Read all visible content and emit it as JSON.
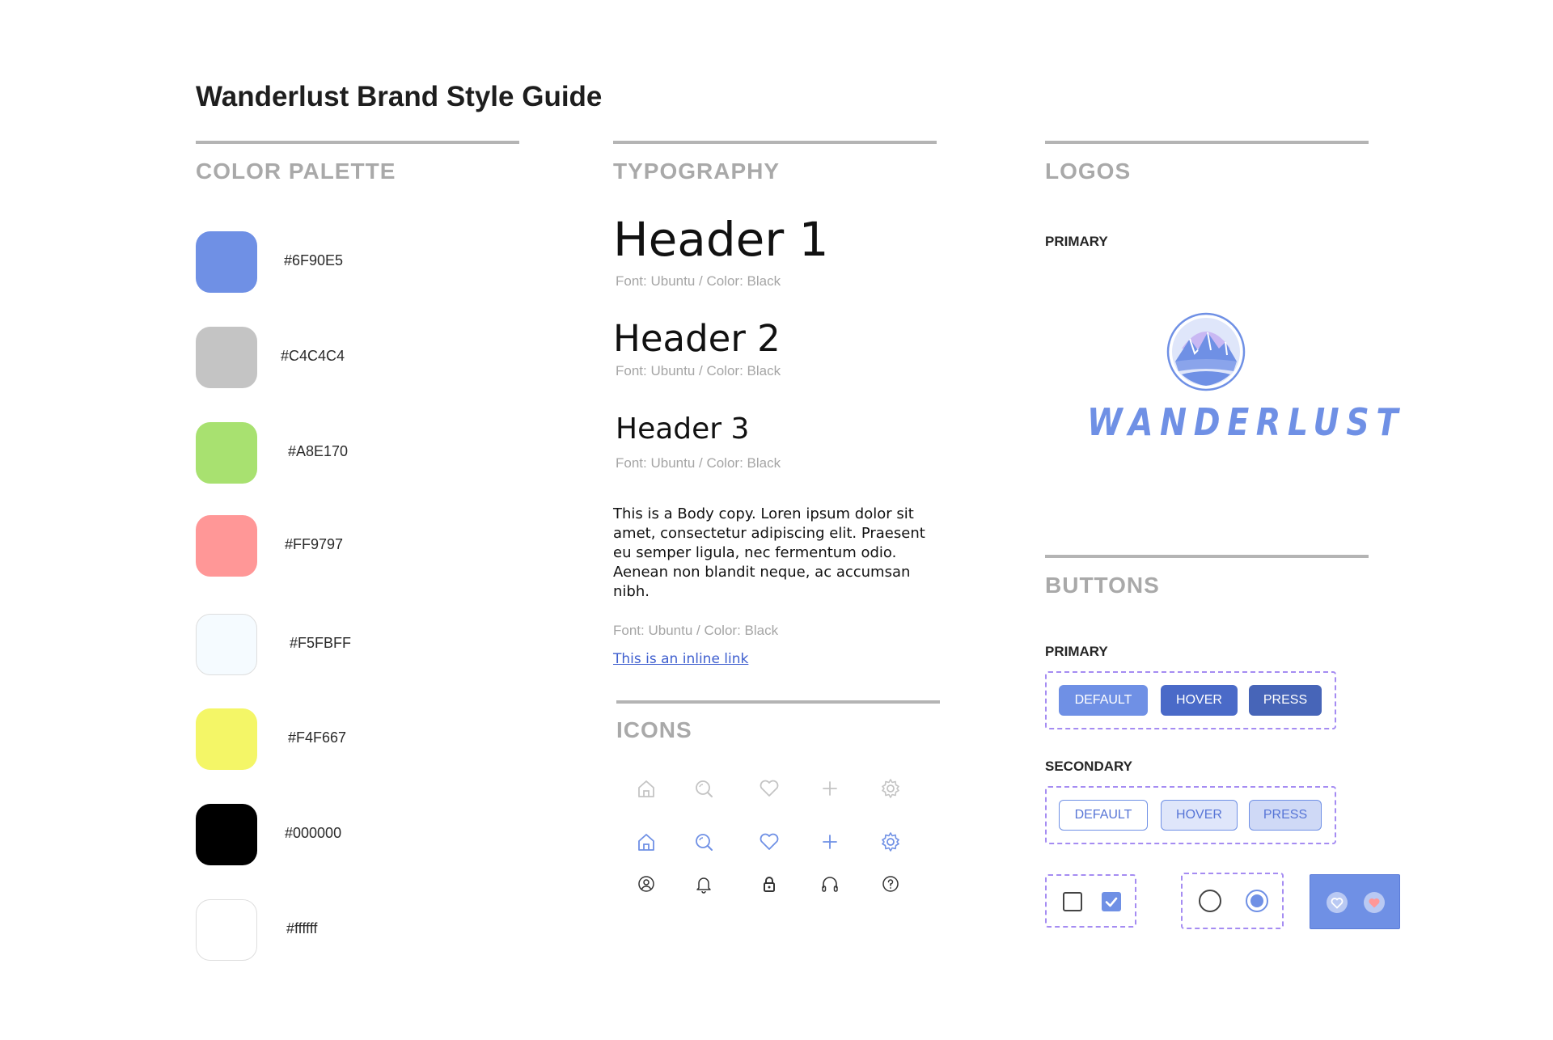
{
  "title": "Wanderlust Brand Style Guide",
  "color_palette": {
    "heading": "COLOR PALETTE",
    "swatches": [
      {
        "hex": "#6F90E5",
        "color": "#6F90E5"
      },
      {
        "hex": "#C4C4C4",
        "color": "#C4C4C4"
      },
      {
        "hex": "#A8E170",
        "color": "#A8E170"
      },
      {
        "hex": "#FF9797",
        "color": "#FF9797"
      },
      {
        "hex": "#F5FBFF",
        "color": "#F5FBFF"
      },
      {
        "hex": "#F4F667",
        "color": "#F4F667"
      },
      {
        "hex": "#000000",
        "color": "#000000"
      },
      {
        "hex": "#ffffff",
        "color": "#ffffff"
      }
    ]
  },
  "typography": {
    "heading": "TYPOGRAPHY",
    "header1": "Header 1",
    "header2": "Header 2",
    "header3": "Header 3",
    "font_note": "Font: Ubuntu / Color: Black",
    "body_copy": "This is a Body copy. Loren ipsum dolor sit amet, consectetur adipiscing elit. Praesent eu semper ligula, nec fermentum odio. Aenean non blandit neque, ac accumsan nibh.",
    "inline_link": "This is an inline link"
  },
  "icons": {
    "heading": "ICONS",
    "row_light": [
      "home-icon",
      "search-icon",
      "heart-icon",
      "plus-icon",
      "gear-icon"
    ],
    "row_accent": [
      "home-icon",
      "search-icon",
      "heart-icon",
      "plus-icon",
      "gear-icon"
    ],
    "row_misc": [
      "user-icon",
      "bell-icon",
      "lock-icon",
      "headphones-icon",
      "help-icon"
    ],
    "light_color": "#C4C4C4",
    "accent_color": "#6F90E5",
    "dark_color": "#333333"
  },
  "logos": {
    "heading": "LOGOS",
    "primary_label": "PRIMARY",
    "wordmark": "WANDERLUST",
    "brand_color": "#6F90E5"
  },
  "buttons": {
    "heading": "BUTTONS",
    "primary_label": "PRIMARY",
    "secondary_label": "SECONDARY",
    "primary": {
      "default": "DEFAULT",
      "hover": "HOVER",
      "press": "PRESS"
    },
    "secondary": {
      "default": "DEFAULT",
      "hover": "HOVER",
      "press": "PRESS"
    },
    "checkbox_states": [
      "unchecked",
      "checked"
    ],
    "radio_states": [
      "unselected",
      "selected"
    ],
    "favorite_states": [
      "inactive",
      "active"
    ],
    "favorite_active_color": "#FF9797"
  }
}
